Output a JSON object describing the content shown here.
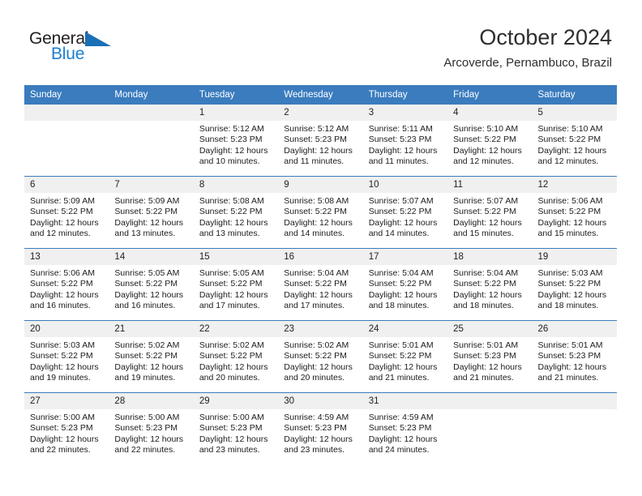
{
  "brand": {
    "name_part1": "General",
    "name_part2": "Blue",
    "accent_color": "#1c7fd0",
    "triangle_color": "#1a6fb5"
  },
  "header": {
    "title": "October 2024",
    "location": "Arcoverde, Pernambuco, Brazil"
  },
  "calendar": {
    "header_color": "#3a7cbe",
    "weekday_headers": [
      "Sunday",
      "Monday",
      "Tuesday",
      "Wednesday",
      "Thursday",
      "Friday",
      "Saturday"
    ],
    "weeks": [
      [
        {
          "day": "",
          "sunrise": "",
          "sunset": "",
          "daylight": "",
          "daylight2": ""
        },
        {
          "day": "",
          "sunrise": "",
          "sunset": "",
          "daylight": "",
          "daylight2": ""
        },
        {
          "day": "1",
          "sunrise": "Sunrise: 5:12 AM",
          "sunset": "Sunset: 5:23 PM",
          "daylight": "Daylight: 12 hours",
          "daylight2": "and 10 minutes."
        },
        {
          "day": "2",
          "sunrise": "Sunrise: 5:12 AM",
          "sunset": "Sunset: 5:23 PM",
          "daylight": "Daylight: 12 hours",
          "daylight2": "and 11 minutes."
        },
        {
          "day": "3",
          "sunrise": "Sunrise: 5:11 AM",
          "sunset": "Sunset: 5:23 PM",
          "daylight": "Daylight: 12 hours",
          "daylight2": "and 11 minutes."
        },
        {
          "day": "4",
          "sunrise": "Sunrise: 5:10 AM",
          "sunset": "Sunset: 5:22 PM",
          "daylight": "Daylight: 12 hours",
          "daylight2": "and 12 minutes."
        },
        {
          "day": "5",
          "sunrise": "Sunrise: 5:10 AM",
          "sunset": "Sunset: 5:22 PM",
          "daylight": "Daylight: 12 hours",
          "daylight2": "and 12 minutes."
        }
      ],
      [
        {
          "day": "6",
          "sunrise": "Sunrise: 5:09 AM",
          "sunset": "Sunset: 5:22 PM",
          "daylight": "Daylight: 12 hours",
          "daylight2": "and 12 minutes."
        },
        {
          "day": "7",
          "sunrise": "Sunrise: 5:09 AM",
          "sunset": "Sunset: 5:22 PM",
          "daylight": "Daylight: 12 hours",
          "daylight2": "and 13 minutes."
        },
        {
          "day": "8",
          "sunrise": "Sunrise: 5:08 AM",
          "sunset": "Sunset: 5:22 PM",
          "daylight": "Daylight: 12 hours",
          "daylight2": "and 13 minutes."
        },
        {
          "day": "9",
          "sunrise": "Sunrise: 5:08 AM",
          "sunset": "Sunset: 5:22 PM",
          "daylight": "Daylight: 12 hours",
          "daylight2": "and 14 minutes."
        },
        {
          "day": "10",
          "sunrise": "Sunrise: 5:07 AM",
          "sunset": "Sunset: 5:22 PM",
          "daylight": "Daylight: 12 hours",
          "daylight2": "and 14 minutes."
        },
        {
          "day": "11",
          "sunrise": "Sunrise: 5:07 AM",
          "sunset": "Sunset: 5:22 PM",
          "daylight": "Daylight: 12 hours",
          "daylight2": "and 15 minutes."
        },
        {
          "day": "12",
          "sunrise": "Sunrise: 5:06 AM",
          "sunset": "Sunset: 5:22 PM",
          "daylight": "Daylight: 12 hours",
          "daylight2": "and 15 minutes."
        }
      ],
      [
        {
          "day": "13",
          "sunrise": "Sunrise: 5:06 AM",
          "sunset": "Sunset: 5:22 PM",
          "daylight": "Daylight: 12 hours",
          "daylight2": "and 16 minutes."
        },
        {
          "day": "14",
          "sunrise": "Sunrise: 5:05 AM",
          "sunset": "Sunset: 5:22 PM",
          "daylight": "Daylight: 12 hours",
          "daylight2": "and 16 minutes."
        },
        {
          "day": "15",
          "sunrise": "Sunrise: 5:05 AM",
          "sunset": "Sunset: 5:22 PM",
          "daylight": "Daylight: 12 hours",
          "daylight2": "and 17 minutes."
        },
        {
          "day": "16",
          "sunrise": "Sunrise: 5:04 AM",
          "sunset": "Sunset: 5:22 PM",
          "daylight": "Daylight: 12 hours",
          "daylight2": "and 17 minutes."
        },
        {
          "day": "17",
          "sunrise": "Sunrise: 5:04 AM",
          "sunset": "Sunset: 5:22 PM",
          "daylight": "Daylight: 12 hours",
          "daylight2": "and 18 minutes."
        },
        {
          "day": "18",
          "sunrise": "Sunrise: 5:04 AM",
          "sunset": "Sunset: 5:22 PM",
          "daylight": "Daylight: 12 hours",
          "daylight2": "and 18 minutes."
        },
        {
          "day": "19",
          "sunrise": "Sunrise: 5:03 AM",
          "sunset": "Sunset: 5:22 PM",
          "daylight": "Daylight: 12 hours",
          "daylight2": "and 18 minutes."
        }
      ],
      [
        {
          "day": "20",
          "sunrise": "Sunrise: 5:03 AM",
          "sunset": "Sunset: 5:22 PM",
          "daylight": "Daylight: 12 hours",
          "daylight2": "and 19 minutes."
        },
        {
          "day": "21",
          "sunrise": "Sunrise: 5:02 AM",
          "sunset": "Sunset: 5:22 PM",
          "daylight": "Daylight: 12 hours",
          "daylight2": "and 19 minutes."
        },
        {
          "day": "22",
          "sunrise": "Sunrise: 5:02 AM",
          "sunset": "Sunset: 5:22 PM",
          "daylight": "Daylight: 12 hours",
          "daylight2": "and 20 minutes."
        },
        {
          "day": "23",
          "sunrise": "Sunrise: 5:02 AM",
          "sunset": "Sunset: 5:22 PM",
          "daylight": "Daylight: 12 hours",
          "daylight2": "and 20 minutes."
        },
        {
          "day": "24",
          "sunrise": "Sunrise: 5:01 AM",
          "sunset": "Sunset: 5:22 PM",
          "daylight": "Daylight: 12 hours",
          "daylight2": "and 21 minutes."
        },
        {
          "day": "25",
          "sunrise": "Sunrise: 5:01 AM",
          "sunset": "Sunset: 5:23 PM",
          "daylight": "Daylight: 12 hours",
          "daylight2": "and 21 minutes."
        },
        {
          "day": "26",
          "sunrise": "Sunrise: 5:01 AM",
          "sunset": "Sunset: 5:23 PM",
          "daylight": "Daylight: 12 hours",
          "daylight2": "and 21 minutes."
        }
      ],
      [
        {
          "day": "27",
          "sunrise": "Sunrise: 5:00 AM",
          "sunset": "Sunset: 5:23 PM",
          "daylight": "Daylight: 12 hours",
          "daylight2": "and 22 minutes."
        },
        {
          "day": "28",
          "sunrise": "Sunrise: 5:00 AM",
          "sunset": "Sunset: 5:23 PM",
          "daylight": "Daylight: 12 hours",
          "daylight2": "and 22 minutes."
        },
        {
          "day": "29",
          "sunrise": "Sunrise: 5:00 AM",
          "sunset": "Sunset: 5:23 PM",
          "daylight": "Daylight: 12 hours",
          "daylight2": "and 23 minutes."
        },
        {
          "day": "30",
          "sunrise": "Sunrise: 4:59 AM",
          "sunset": "Sunset: 5:23 PM",
          "daylight": "Daylight: 12 hours",
          "daylight2": "and 23 minutes."
        },
        {
          "day": "31",
          "sunrise": "Sunrise: 4:59 AM",
          "sunset": "Sunset: 5:23 PM",
          "daylight": "Daylight: 12 hours",
          "daylight2": "and 24 minutes."
        },
        {
          "day": "",
          "sunrise": "",
          "sunset": "",
          "daylight": "",
          "daylight2": ""
        },
        {
          "day": "",
          "sunrise": "",
          "sunset": "",
          "daylight": "",
          "daylight2": ""
        }
      ]
    ]
  }
}
